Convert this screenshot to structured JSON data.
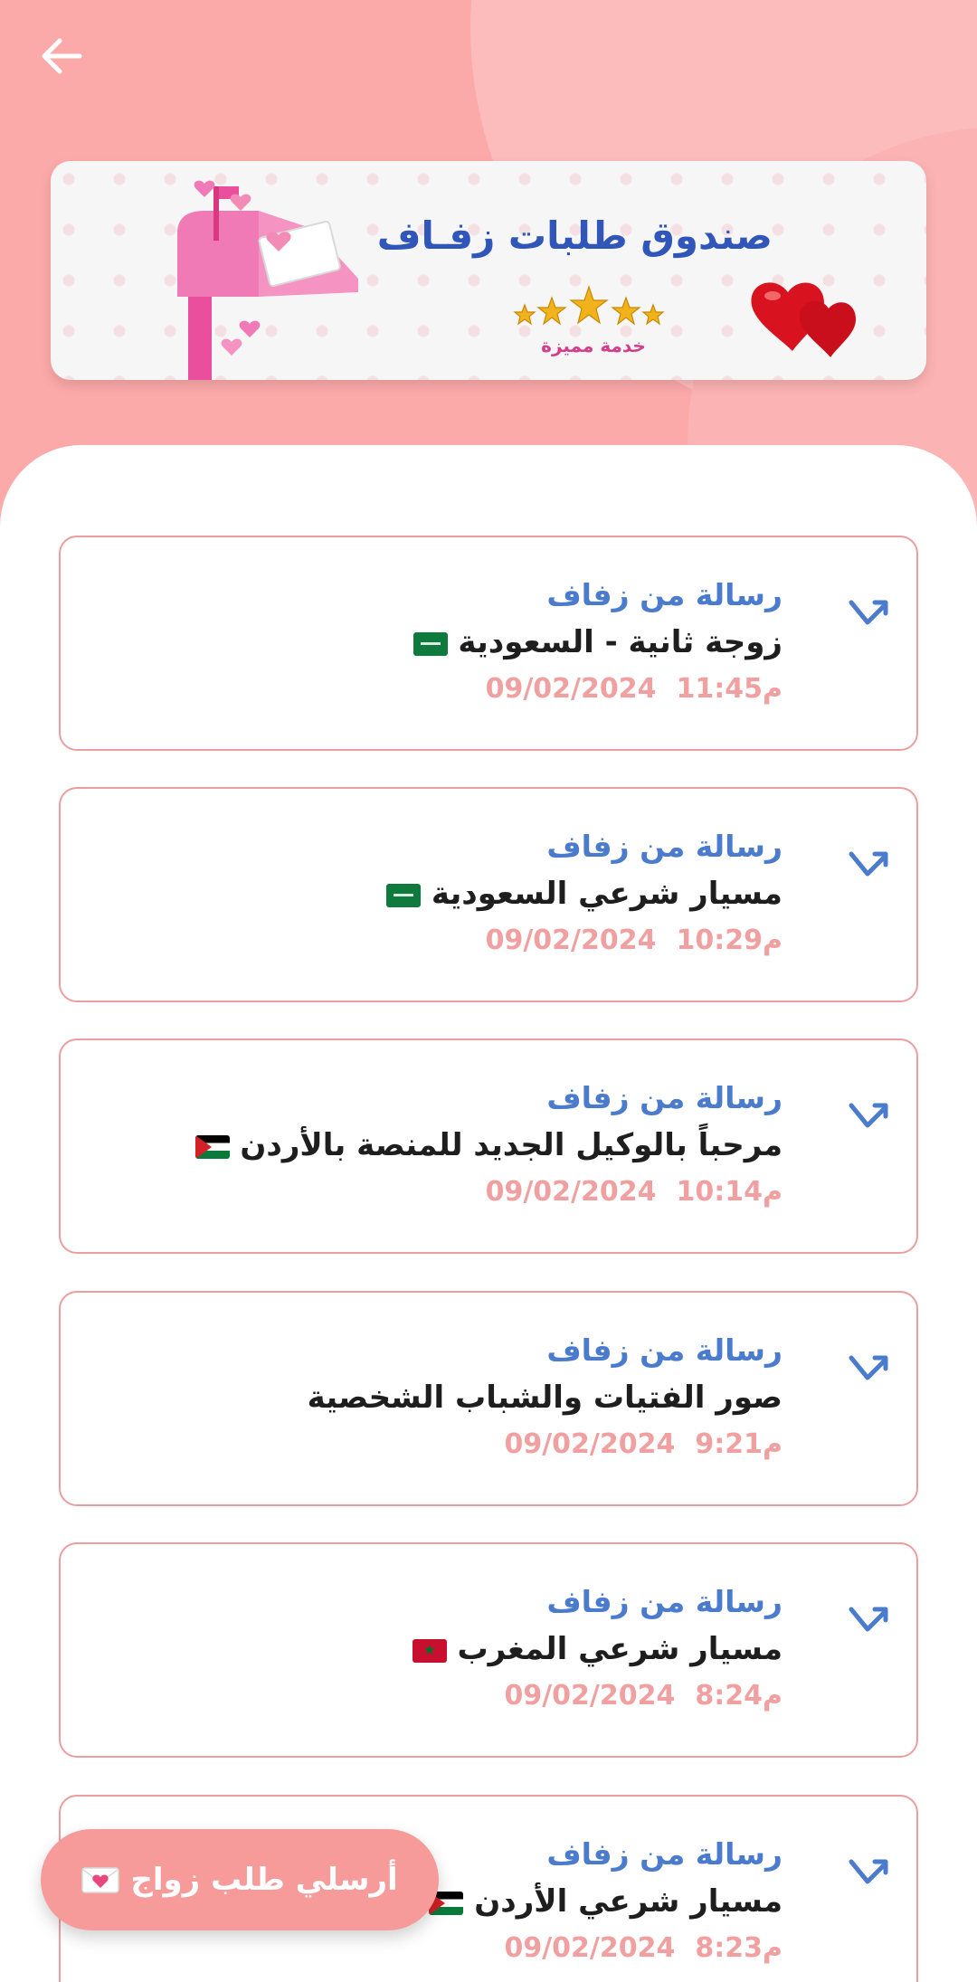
{
  "header": {
    "back_icon": "arrow-left-icon"
  },
  "banner": {
    "title": "صندوق طلبات زفـاف",
    "service_label": "خدمة مميزة",
    "stars": 5
  },
  "colors": {
    "top_background": "#fca9a9",
    "accent_blue": "#4a7bcd",
    "title_blue": "#2f56b8",
    "card_border": "#ec9e9e",
    "timestamp": "#f0a0a0",
    "fab": "#f79a9a"
  },
  "messages": [
    {
      "sender": "رسالة من زفاف",
      "subject": "زوجة ثانية - السعودية",
      "flag": "sa",
      "date": "09/02/2024",
      "time": "11:45م"
    },
    {
      "sender": "رسالة من زفاف",
      "subject": "مسيار شرعي السعودية",
      "flag": "sa",
      "date": "09/02/2024",
      "time": "10:29م"
    },
    {
      "sender": "رسالة من زفاف",
      "subject": "مرحباً بالوكيل الجديد للمنصة بالأردن",
      "flag": "jo",
      "date": "09/02/2024",
      "time": "10:14م"
    },
    {
      "sender": "رسالة من زفاف",
      "subject": "صور الفتيات والشباب الشخصية",
      "flag": "",
      "date": "09/02/2024",
      "time": "9:21م"
    },
    {
      "sender": "رسالة من زفاف",
      "subject": "مسيار شرعي المغرب",
      "flag": "ma",
      "date": "09/02/2024",
      "time": "8:24م"
    },
    {
      "sender": "رسالة من زفاف",
      "subject": "مسيار شرعي الأردن",
      "flag": "jo",
      "date": "09/02/2024",
      "time": "8:23م"
    }
  ],
  "fab": {
    "label": "أرسلي طلب زواج",
    "icon": "love-letter-icon"
  }
}
